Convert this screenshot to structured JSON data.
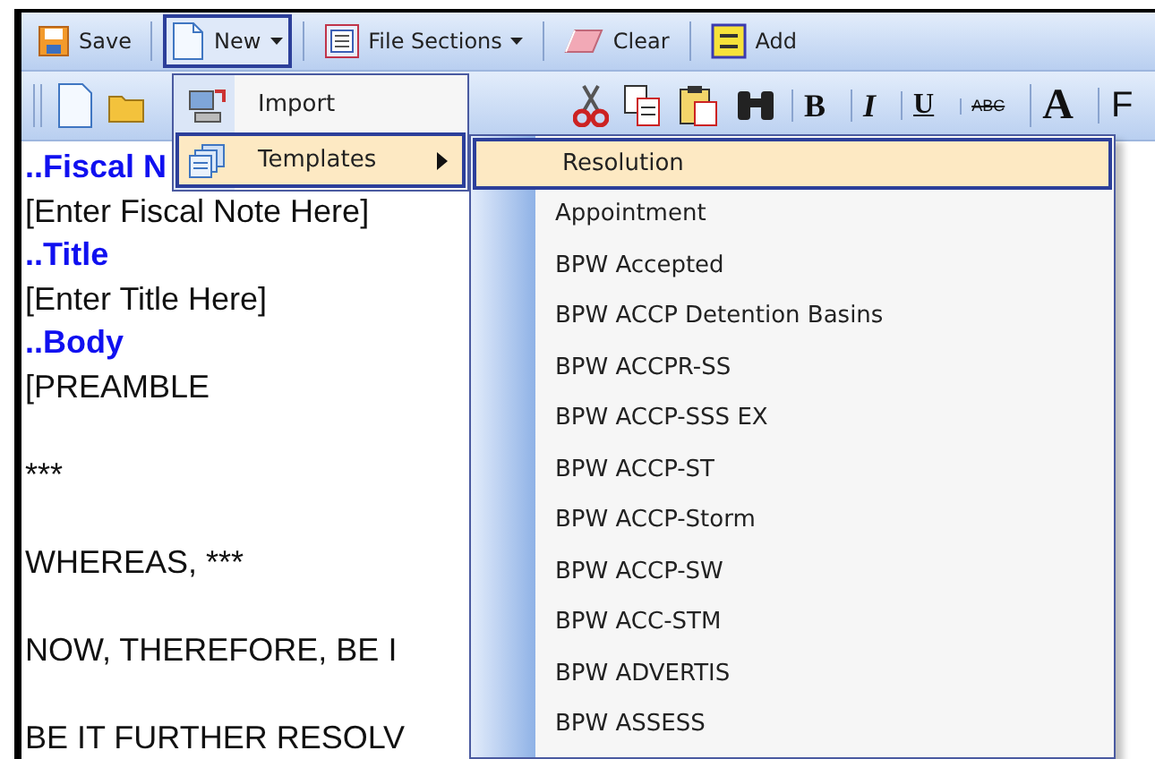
{
  "toolbar": [
    {
      "kind": "save",
      "label": "Save",
      "pressed": false,
      "caret": false
    },
    {
      "kind": "new",
      "label": "New",
      "pressed": true,
      "caret": true
    },
    {
      "kind": "sections",
      "label": "File Sections",
      "pressed": false,
      "caret": true
    },
    {
      "kind": "clear",
      "label": "Clear",
      "pressed": false,
      "caret": false
    },
    {
      "kind": "add",
      "label": "Add",
      "pressed": false,
      "caret": false
    }
  ],
  "format_toolbar": [
    "B",
    "I",
    "U",
    "ABC",
    "A",
    "F"
  ],
  "editor": {
    "lines": [
      {
        "kind": "heading",
        "text": "..Fiscal N"
      },
      {
        "kind": "text",
        "text": "[Enter Fiscal Note Here]"
      },
      {
        "kind": "heading",
        "text": "..Title"
      },
      {
        "kind": "text",
        "text": "[Enter Title Here]"
      },
      {
        "kind": "heading",
        "text": "..Body"
      },
      {
        "kind": "text",
        "text": "[PREAMBLE"
      }
    ],
    "paragraphs": [
      "***",
      "WHEREAS, ***",
      "NOW, THEREFORE, BE I",
      "BE IT FURTHER RESOLV"
    ]
  },
  "new_menu": [
    {
      "kind": "import",
      "label": "Import",
      "selected": false,
      "submenu": false
    },
    {
      "kind": "templates",
      "label": "Templates",
      "selected": true,
      "submenu": true
    }
  ],
  "templates_menu": [
    {
      "label": "Resolution",
      "selected": true
    },
    {
      "label": "Appointment",
      "selected": false
    },
    {
      "label": "BPW Accepted",
      "selected": false
    },
    {
      "label": "BPW ACCP Detention Basins",
      "selected": false
    },
    {
      "label": "BPW ACCPR-SS",
      "selected": false
    },
    {
      "label": "BPW ACCP-SSS EX",
      "selected": false
    },
    {
      "label": "BPW ACCP-ST",
      "selected": false
    },
    {
      "label": "BPW ACCP-Storm",
      "selected": false
    },
    {
      "label": "BPW ACCP-SW",
      "selected": false
    },
    {
      "label": "BPW ACC-STM",
      "selected": false
    },
    {
      "label": "BPW ADVERTIS",
      "selected": false
    },
    {
      "label": "BPW ASSESS",
      "selected": false
    }
  ]
}
